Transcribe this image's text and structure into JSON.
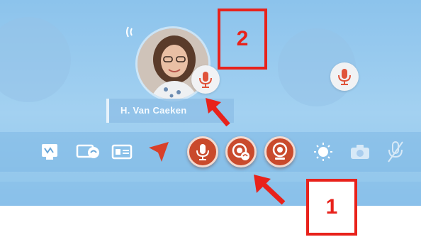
{
  "participant": {
    "name": "H. Van Caeken"
  },
  "callouts": {
    "one": "1",
    "two": "2"
  },
  "icons": {
    "signal": "signal-wave-icon",
    "user_mic": "microphone-icon",
    "peer_mic": "microphone-icon",
    "tools": [
      "whiteboard-icon",
      "screen-share-icon",
      "id-card-icon",
      "pointer-icon",
      "microphone-icon",
      "camera-share-icon",
      "webcam-icon",
      "brightness-icon",
      "camera-icon",
      "mute-microphone-icon"
    ]
  },
  "colors": {
    "accent": "#c94a2c",
    "mic_red": "#e0533a",
    "callout_red": "#e8221b",
    "background": "#9fcdf0"
  }
}
